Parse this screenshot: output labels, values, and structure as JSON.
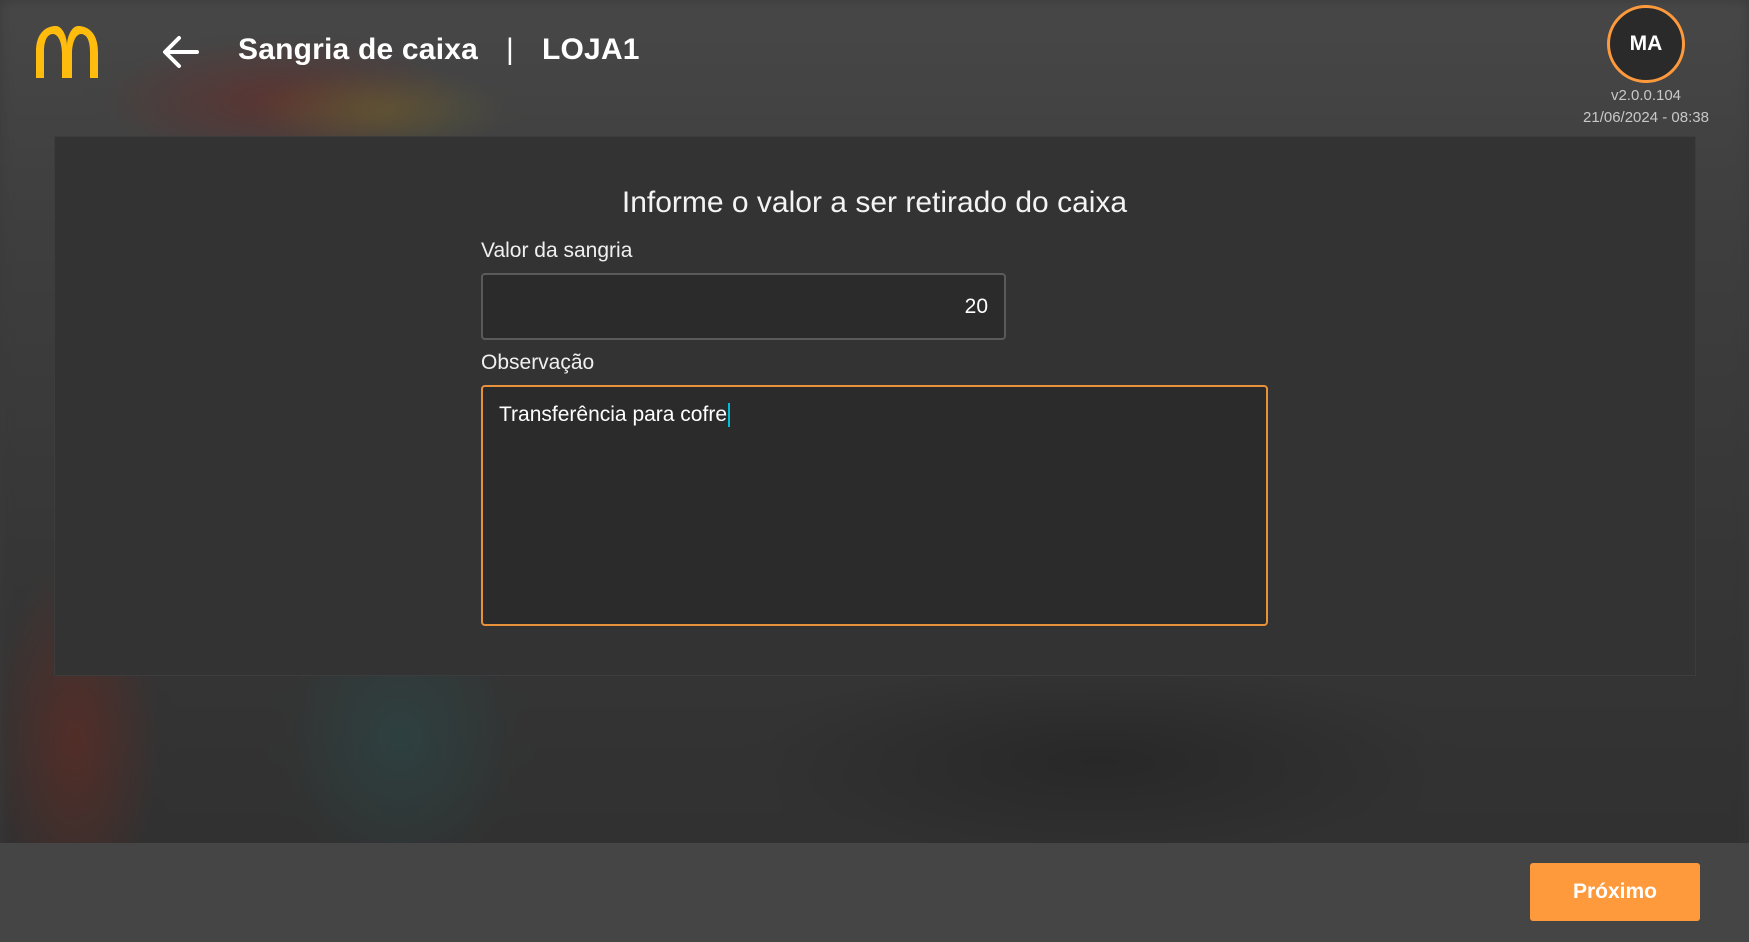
{
  "header": {
    "logo_icon": "mcdonalds-arches-logo",
    "back_icon": "arrow-left-icon",
    "title": "Sangria de caixa",
    "separator": "|",
    "store": "LOJA1",
    "user_initials": "MA",
    "version": "v2.0.0.104",
    "datetime": "21/06/2024 - 08:38"
  },
  "form": {
    "heading": "Informe o valor a ser retirado do caixa",
    "value_label": "Valor da sangria",
    "value": "20",
    "observation_label": "Observação",
    "observation": "Transferência para cofre"
  },
  "footer": {
    "next_label": "Próximo"
  },
  "colors": {
    "accent": "#ff9a3c",
    "logo": "#ffbc0d",
    "focus_border": "#e8903a",
    "caret": "#00bcd4"
  }
}
